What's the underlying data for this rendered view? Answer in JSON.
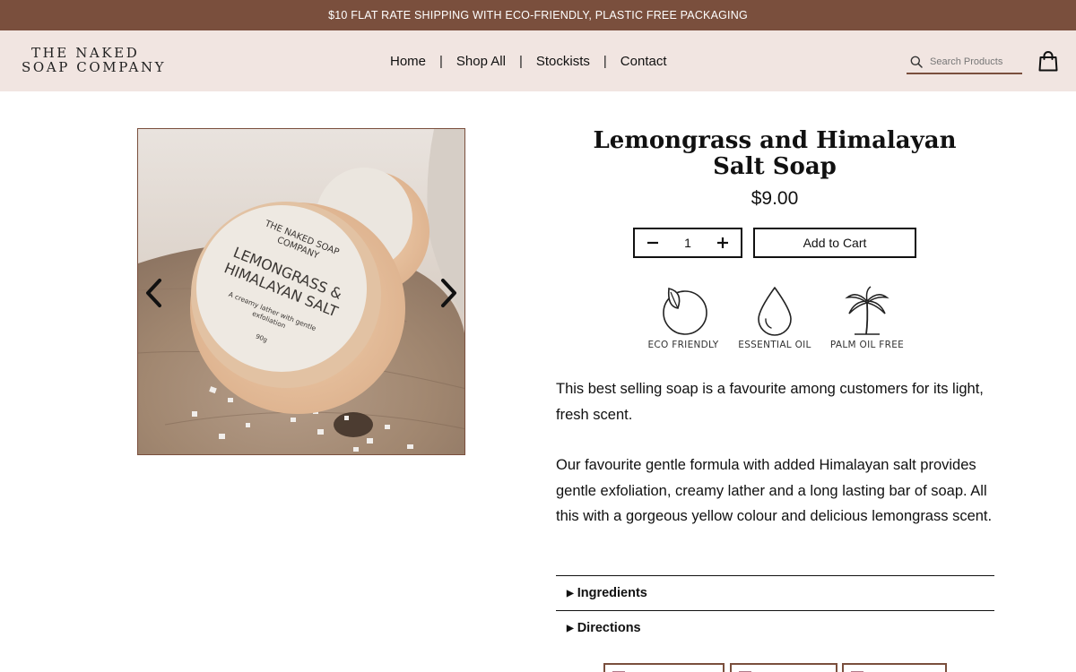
{
  "announcement": "$10 FLAT RATE SHIPPING WITH ECO-FRIENDLY, PLASTIC FREE PACKAGING",
  "brand": {
    "line1": "THE NAKED",
    "line2": "SOAP COMPANY"
  },
  "nav": {
    "items": [
      {
        "label": "Home"
      },
      {
        "label": "Shop All"
      },
      {
        "label": "Stockists"
      },
      {
        "label": "Contact"
      }
    ],
    "separator": "|"
  },
  "search": {
    "placeholder": "Search Products",
    "value": ""
  },
  "icons": {
    "search": "search-icon",
    "cart": "shopping-bag-icon",
    "prev": "chevron-left-icon",
    "next": "chevron-right-icon"
  },
  "product": {
    "title_line1": "Lemongrass and Himalayan",
    "title_line2": "Salt Soap",
    "price": "$9.00",
    "quantity": "1",
    "add_to_cart": "Add to Cart",
    "soap_label": {
      "brand1": "THE NAKED SOAP",
      "brand2": "COMPANY",
      "name1": "LEMONGRASS &",
      "name2": "HIMALAYAN SALT",
      "desc1": "A creamy lather with gentle",
      "desc2": "exfoliation",
      "weight": "90g"
    },
    "badges": [
      {
        "label": "ECO FRIENDLY",
        "icon": "leaf-circle-icon"
      },
      {
        "label": "ESSENTIAL OIL",
        "icon": "drop-icon"
      },
      {
        "label": "PALM OIL FREE",
        "icon": "palm-tree-icon"
      }
    ],
    "description": [
      "This best selling soap is a favourite among customers for its light, fresh scent.",
      "Our favourite gentle formula with added Himalayan salt provides gentle exfoliation, creamy lather and a long lasting bar of soap. All this with a gorgeous yellow colour and delicious lemongrass scent."
    ],
    "accordions": [
      {
        "label": "Ingredients"
      },
      {
        "label": "Directions"
      }
    ]
  },
  "colors": {
    "brand_brown": "#7a4f3d",
    "header_bg": "#f1e5e1"
  }
}
